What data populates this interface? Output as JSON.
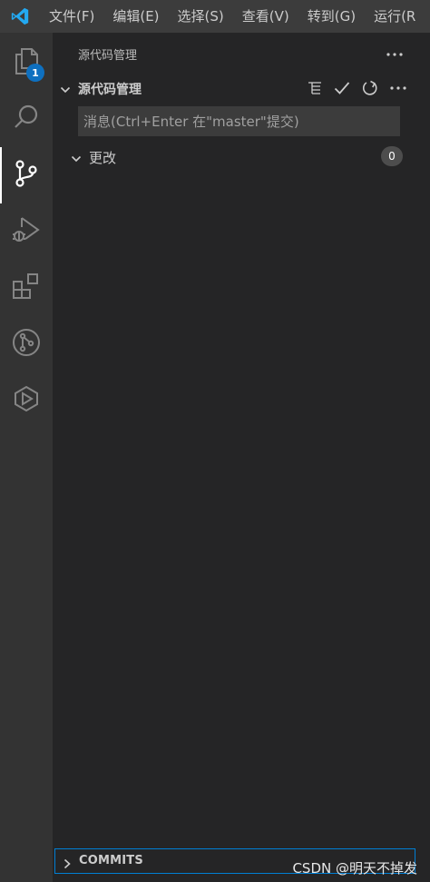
{
  "menubar": {
    "items": [
      "文件(F)",
      "编辑(E)",
      "选择(S)",
      "查看(V)",
      "转到(G)",
      "运行(R"
    ]
  },
  "activity": {
    "explorer_badge": "1"
  },
  "sidebar": {
    "title": "源代码管理",
    "section_title": "源代码管理",
    "commit_placeholder": "消息(Ctrl+Enter 在\"master\"提交)",
    "changes_label": "更改",
    "changes_count": "0",
    "commits_label": "COMMITS"
  },
  "watermark": "CSDN @明天不掉发",
  "colors": {
    "accent": "#0e70c0",
    "activitybar": "#333333",
    "sidebar": "#252526",
    "input": "#3c3c3c",
    "focus_border": "#007fd4"
  }
}
